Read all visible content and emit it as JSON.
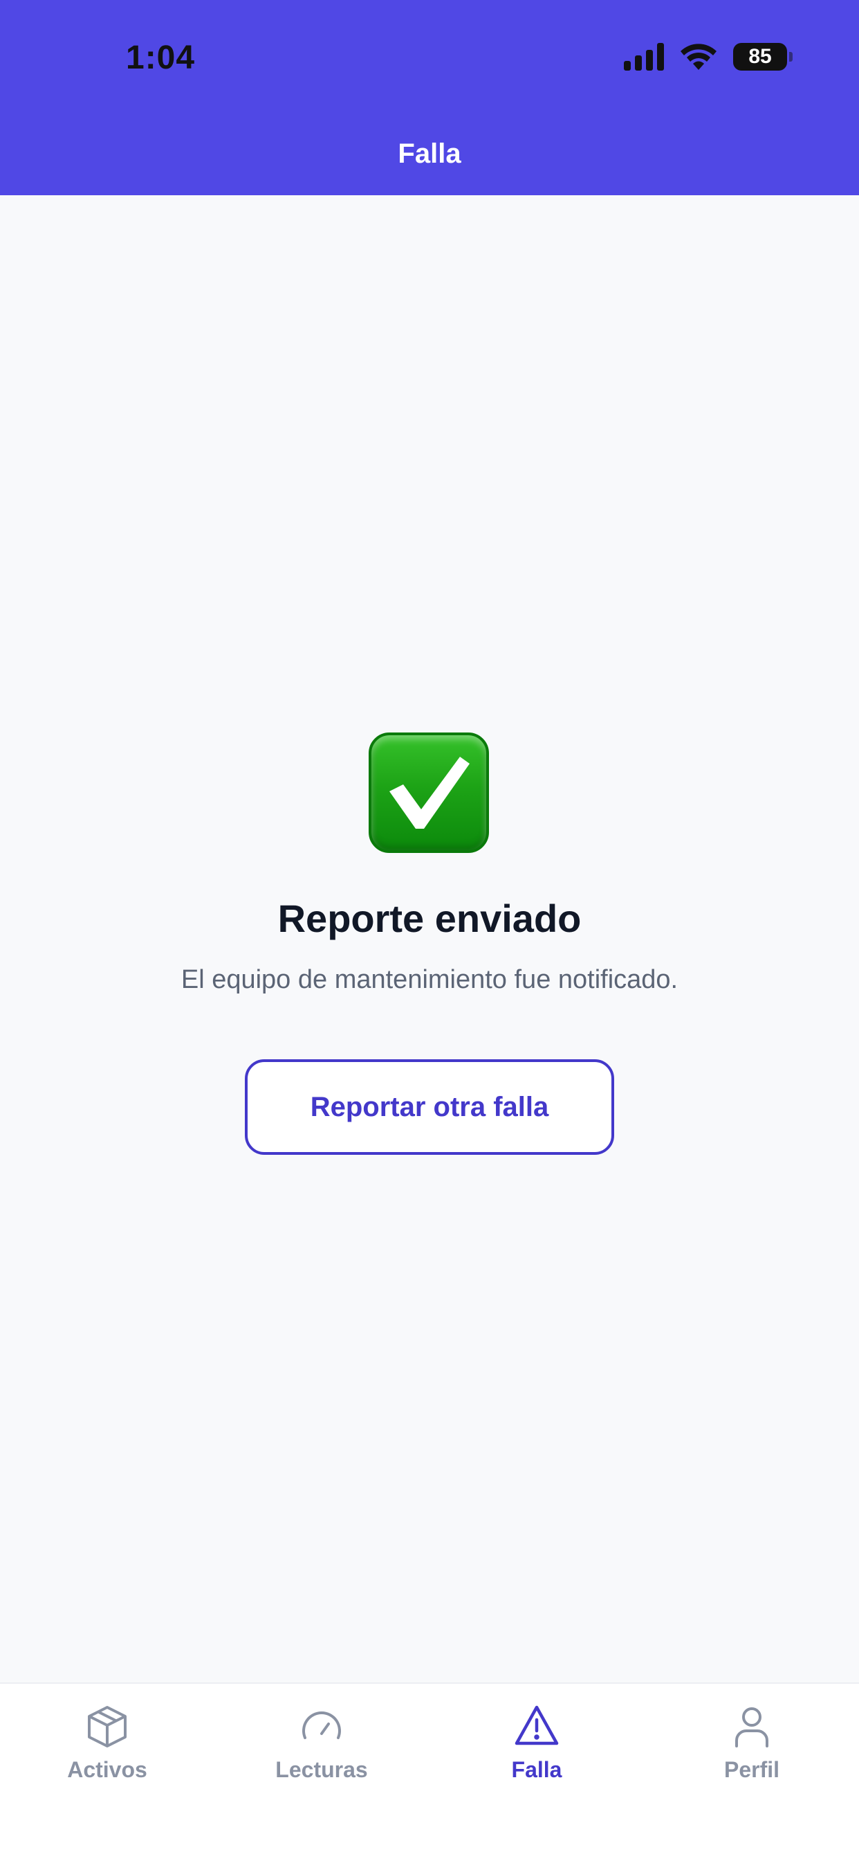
{
  "status_bar": {
    "time": "1:04",
    "battery": "85"
  },
  "header": {
    "title": "Falla"
  },
  "confirmation": {
    "icon": "check-mark-button-icon",
    "title": "Reporte enviado",
    "message": "El equipo de mantenimiento fue notificado.",
    "button_label": "Reportar otra falla"
  },
  "tabs": [
    {
      "label": "Activos",
      "icon": "box-icon",
      "active": false
    },
    {
      "label": "Lecturas",
      "icon": "gauge-icon",
      "active": false
    },
    {
      "label": "Falla",
      "icon": "warning-triangle-icon",
      "active": true
    },
    {
      "label": "Perfil",
      "icon": "user-icon",
      "active": false
    }
  ],
  "colors": {
    "header_bg": "#5048e5",
    "accent": "#4338ca",
    "inactive_tab": "#8a92a3",
    "success_green": "#1da316"
  }
}
